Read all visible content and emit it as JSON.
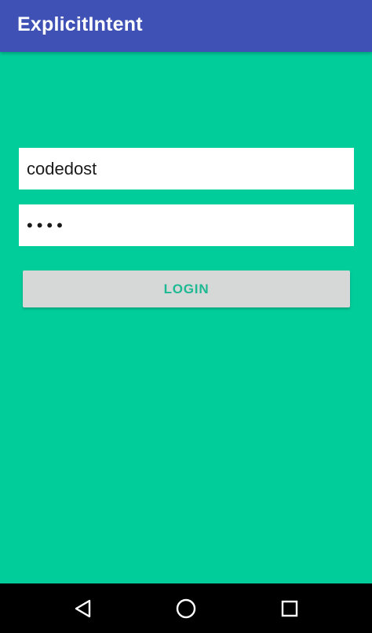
{
  "app_bar": {
    "title": "ExplicitIntent",
    "color": "#3F51B5"
  },
  "background_color": "#01CD9B",
  "form": {
    "username": {
      "value": "codedost",
      "placeholder": ""
    },
    "password": {
      "value": "••••",
      "placeholder": ""
    },
    "login_button": {
      "label": "LOGIN",
      "text_color": "#1DB992"
    }
  },
  "nav_bar": {
    "items": [
      {
        "icon": "back-triangle-icon"
      },
      {
        "icon": "home-circle-icon"
      },
      {
        "icon": "recent-apps-square-icon"
      }
    ]
  }
}
